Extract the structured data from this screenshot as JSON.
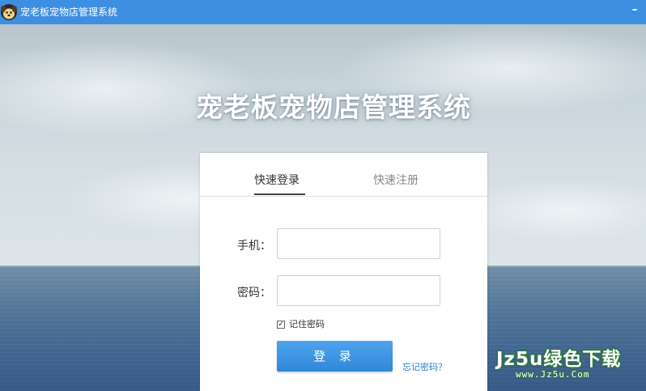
{
  "window": {
    "title": "宠老板宠物店管理系统",
    "logo_icon": "dog-face-icon",
    "minimize_label": "–"
  },
  "hero": {
    "title": "宠老板宠物店管理系统"
  },
  "tabs": [
    {
      "label": "快速登录",
      "active": true
    },
    {
      "label": "快速注册",
      "active": false
    }
  ],
  "form": {
    "phone_label": "手机：",
    "phone_value": "",
    "password_label": "密码：",
    "password_value": "",
    "remember_label": "记住密码",
    "remember_checked": true,
    "login_label": "登 录",
    "forgot_label": "忘记密码？"
  },
  "watermark": {
    "main": "Jz5u绿色下载",
    "sub": "www.Jz5u.Com"
  },
  "colors": {
    "titlebar": "#3d8fe2",
    "login_button": "#3a93e0",
    "link": "#2f7fd0",
    "watermark_outline": "#2c7a37"
  }
}
